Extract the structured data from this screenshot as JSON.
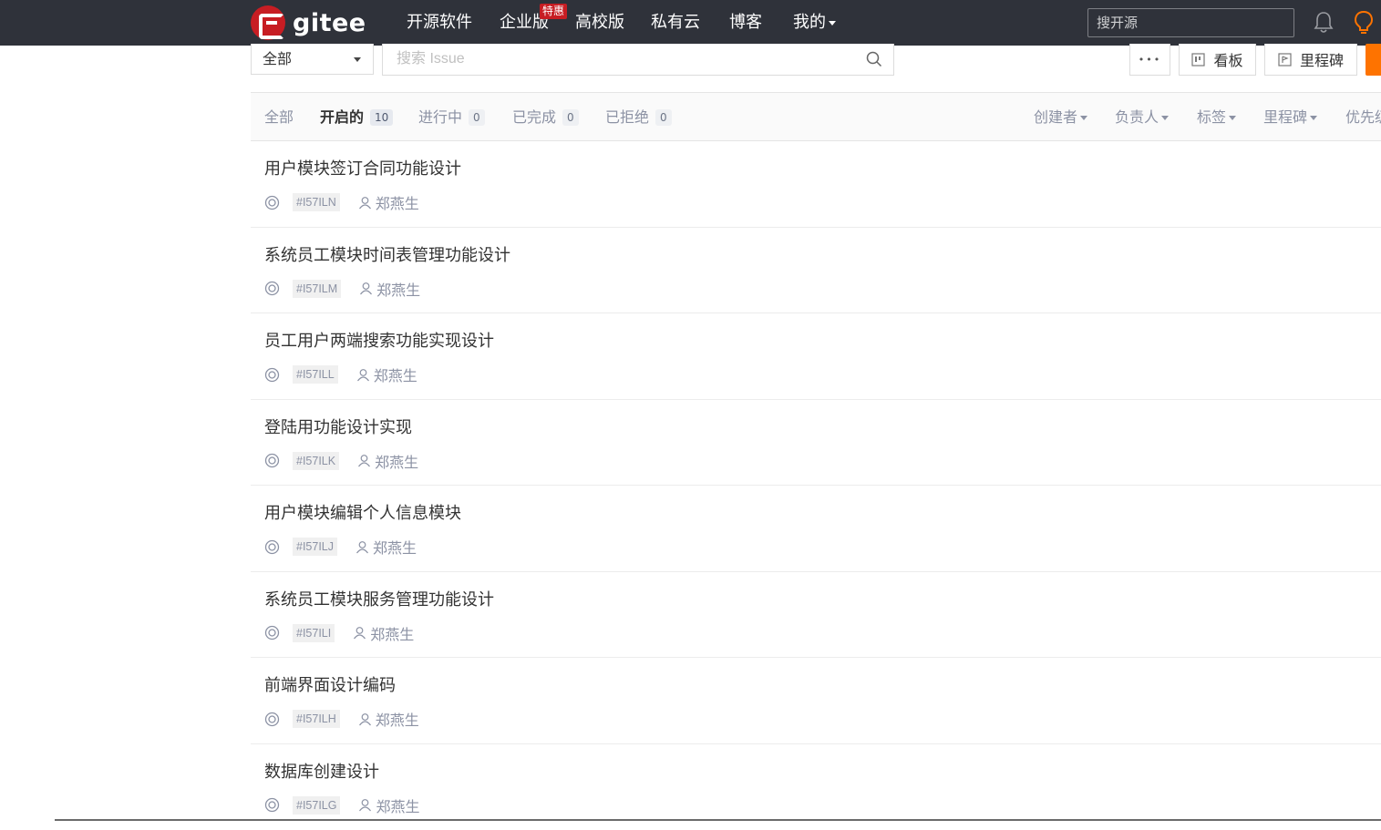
{
  "nav": {
    "logo_text": "gitee",
    "items": [
      "开源软件",
      "企业版",
      "高校版",
      "私有云",
      "博客",
      "我的"
    ],
    "badge": "特惠",
    "search_placeholder": "搜开源"
  },
  "toolbar": {
    "scope_select": "全部",
    "issue_search_placeholder": "搜索 Issue",
    "more_label": "•••",
    "board_label": "看板",
    "milestone_label": "里程碑"
  },
  "tabs": [
    {
      "label": "全部",
      "count": null
    },
    {
      "label": "开启的",
      "count": "10"
    },
    {
      "label": "进行中",
      "count": "0"
    },
    {
      "label": "已完成",
      "count": "0"
    },
    {
      "label": "已拒绝",
      "count": "0"
    }
  ],
  "filters": [
    "创建者",
    "负责人",
    "标签",
    "里程碑",
    "优先级"
  ],
  "issues": [
    {
      "title": "用户模块签订合同功能设计",
      "id": "#I57ILN",
      "assignee": "郑燕生"
    },
    {
      "title": "系统员工模块时间表管理功能设计",
      "id": "#I57ILM",
      "assignee": "郑燕生"
    },
    {
      "title": "员工用户两端搜索功能实现设计",
      "id": "#I57ILL",
      "assignee": "郑燕生"
    },
    {
      "title": "登陆用功能设计实现",
      "id": "#I57ILK",
      "assignee": "郑燕生"
    },
    {
      "title": "用户模块编辑个人信息模块",
      "id": "#I57ILJ",
      "assignee": "郑燕生"
    },
    {
      "title": "系统员工模块服务管理功能设计",
      "id": "#I57ILI",
      "assignee": "郑燕生"
    },
    {
      "title": "前端界面设计编码",
      "id": "#I57ILH",
      "assignee": "郑燕生"
    },
    {
      "title": "数据库创建设计",
      "id": "#I57ILG",
      "assignee": "郑燕生"
    }
  ],
  "colors": {
    "navbar": "#2f323a",
    "brand_red": "#c71d23",
    "accent_orange": "#fe7300"
  }
}
